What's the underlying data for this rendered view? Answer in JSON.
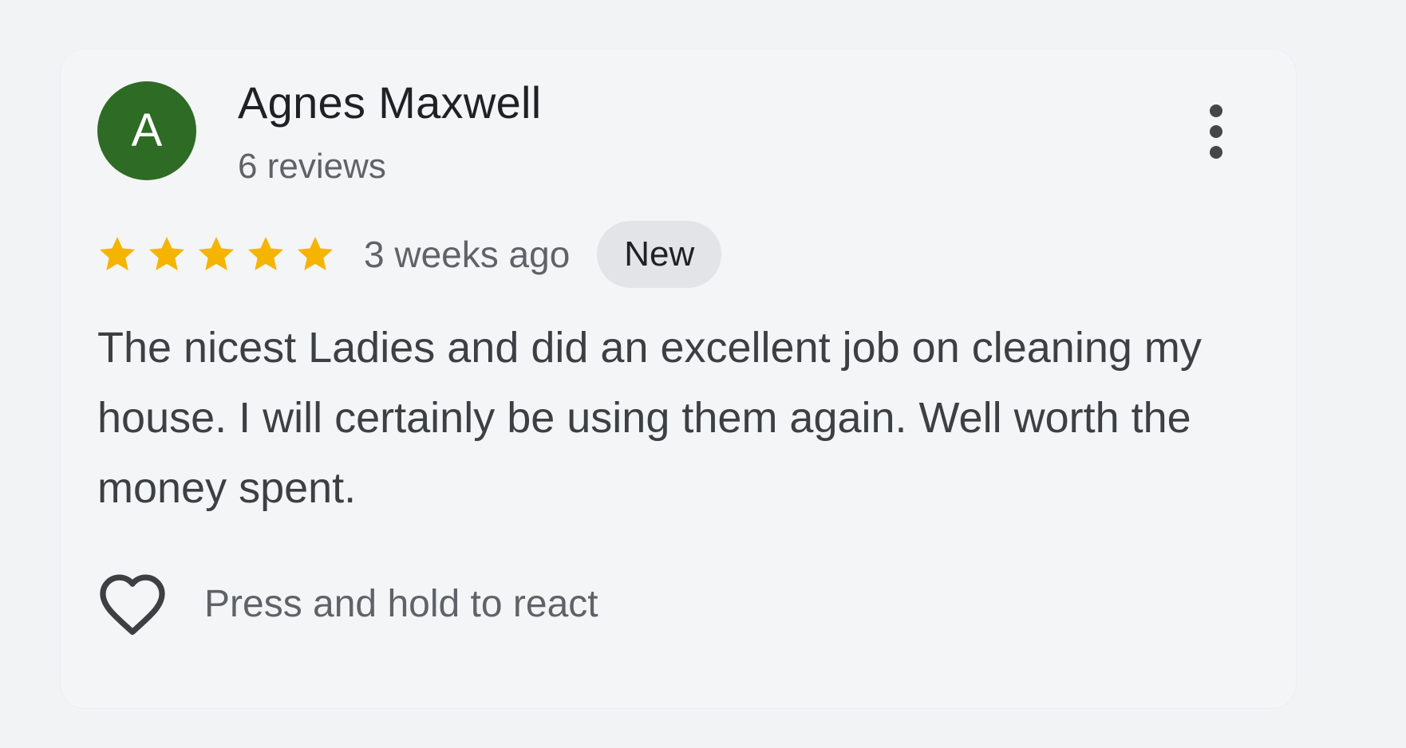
{
  "review": {
    "avatar_initial": "A",
    "author_name": "Agnes Maxwell",
    "author_meta": "6 reviews",
    "rating": 5,
    "rating_max": 5,
    "time_ago": "3 weeks ago",
    "badge": "New",
    "text": "The nicest Ladies and did an excellent job on cleaning my house. I will certainly be using them again. Well worth the money spent.",
    "react_label": "Press and hold to react"
  },
  "icons": {
    "more": "more-vert-icon",
    "star": "star-icon",
    "react": "heart-outline-icon"
  },
  "colors": {
    "avatar_bg": "#2e6b25",
    "star": "#f5b400",
    "badge_bg": "#e2e4e7",
    "card_bg": "#f4f5f7"
  }
}
